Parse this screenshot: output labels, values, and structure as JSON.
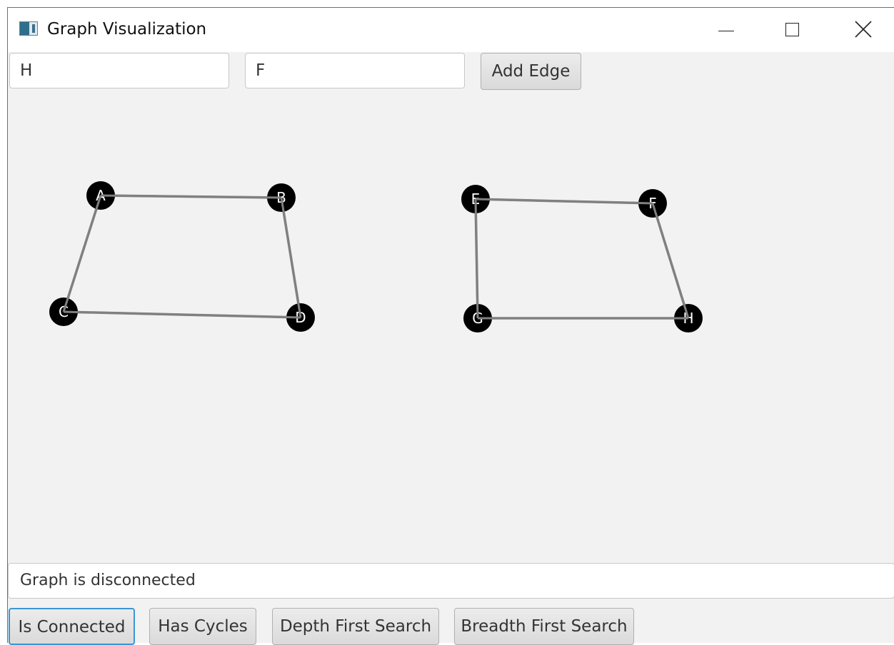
{
  "window": {
    "title": "Graph Visualization"
  },
  "inputs": {
    "from_value": "H",
    "to_value": "F"
  },
  "toolbar": {
    "add_edge_label": "Add Edge"
  },
  "graph": {
    "nodes": [
      {
        "id": "A"
      },
      {
        "id": "B"
      },
      {
        "id": "C"
      },
      {
        "id": "D"
      },
      {
        "id": "E"
      },
      {
        "id": "F"
      },
      {
        "id": "G"
      },
      {
        "id": "H"
      }
    ],
    "edges": [
      [
        "A",
        "B"
      ],
      [
        "A",
        "C"
      ],
      [
        "B",
        "D"
      ],
      [
        "C",
        "D"
      ],
      [
        "E",
        "F"
      ],
      [
        "E",
        "G"
      ],
      [
        "F",
        "H"
      ],
      [
        "G",
        "H"
      ]
    ]
  },
  "status": {
    "text": "Graph is disconnected"
  },
  "actions": {
    "is_connected": "Is Connected",
    "has_cycles": "Has Cycles",
    "dfs": "Depth First Search",
    "bfs": "Breadth First Search"
  },
  "colors": {
    "node": "#000000",
    "edge": "#808080",
    "focus": "#3b96d4"
  }
}
